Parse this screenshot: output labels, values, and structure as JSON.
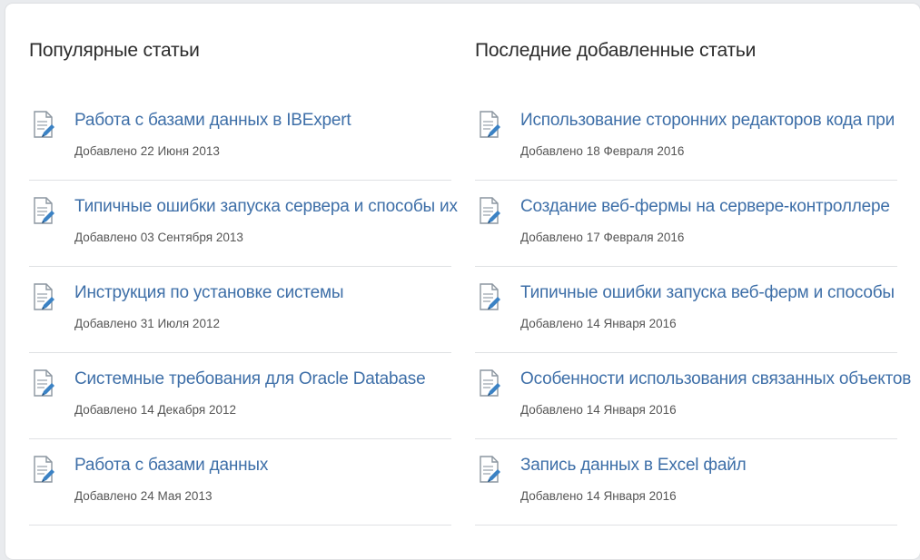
{
  "popular": {
    "title": "Популярные статьи",
    "items": [
      {
        "title": "Работа с базами данных в IBExpert",
        "date": "Добавлено 22 Июня 2013"
      },
      {
        "title": "Типичные ошибки запуска сервера и способы их",
        "date": "Добавлено 03 Сентября 2013"
      },
      {
        "title": "Инструкция по установке системы",
        "date": "Добавлено 31 Июля 2012"
      },
      {
        "title": "Системные требования для Oracle Database",
        "date": "Добавлено 14 Декабря 2012"
      },
      {
        "title": "Работа с базами данных",
        "date": "Добавлено 24 Мая 2013"
      }
    ]
  },
  "recent": {
    "title": "Последние добавленные статьи",
    "items": [
      {
        "title": "Использование сторонних редакторов кода при",
        "date": "Добавлено 18 Февраля 2016"
      },
      {
        "title": "Создание веб-фермы на сервере-контроллере",
        "date": "Добавлено 17 Февраля 2016"
      },
      {
        "title": "Типичные ошибки запуска веб-ферм и способы",
        "date": "Добавлено 14 Января 2016"
      },
      {
        "title": "Особенности использования связанных объектов",
        "date": "Добавлено 14 Января 2016"
      },
      {
        "title": "Запись данных в Excel файл",
        "date": "Добавлено 14 Января 2016"
      }
    ]
  },
  "icon": {
    "name": "document-edit-icon"
  },
  "colors": {
    "link": "#3e6fa8",
    "text": "#2b2b2b",
    "muted": "#555555",
    "divider": "#dfe1e4"
  }
}
